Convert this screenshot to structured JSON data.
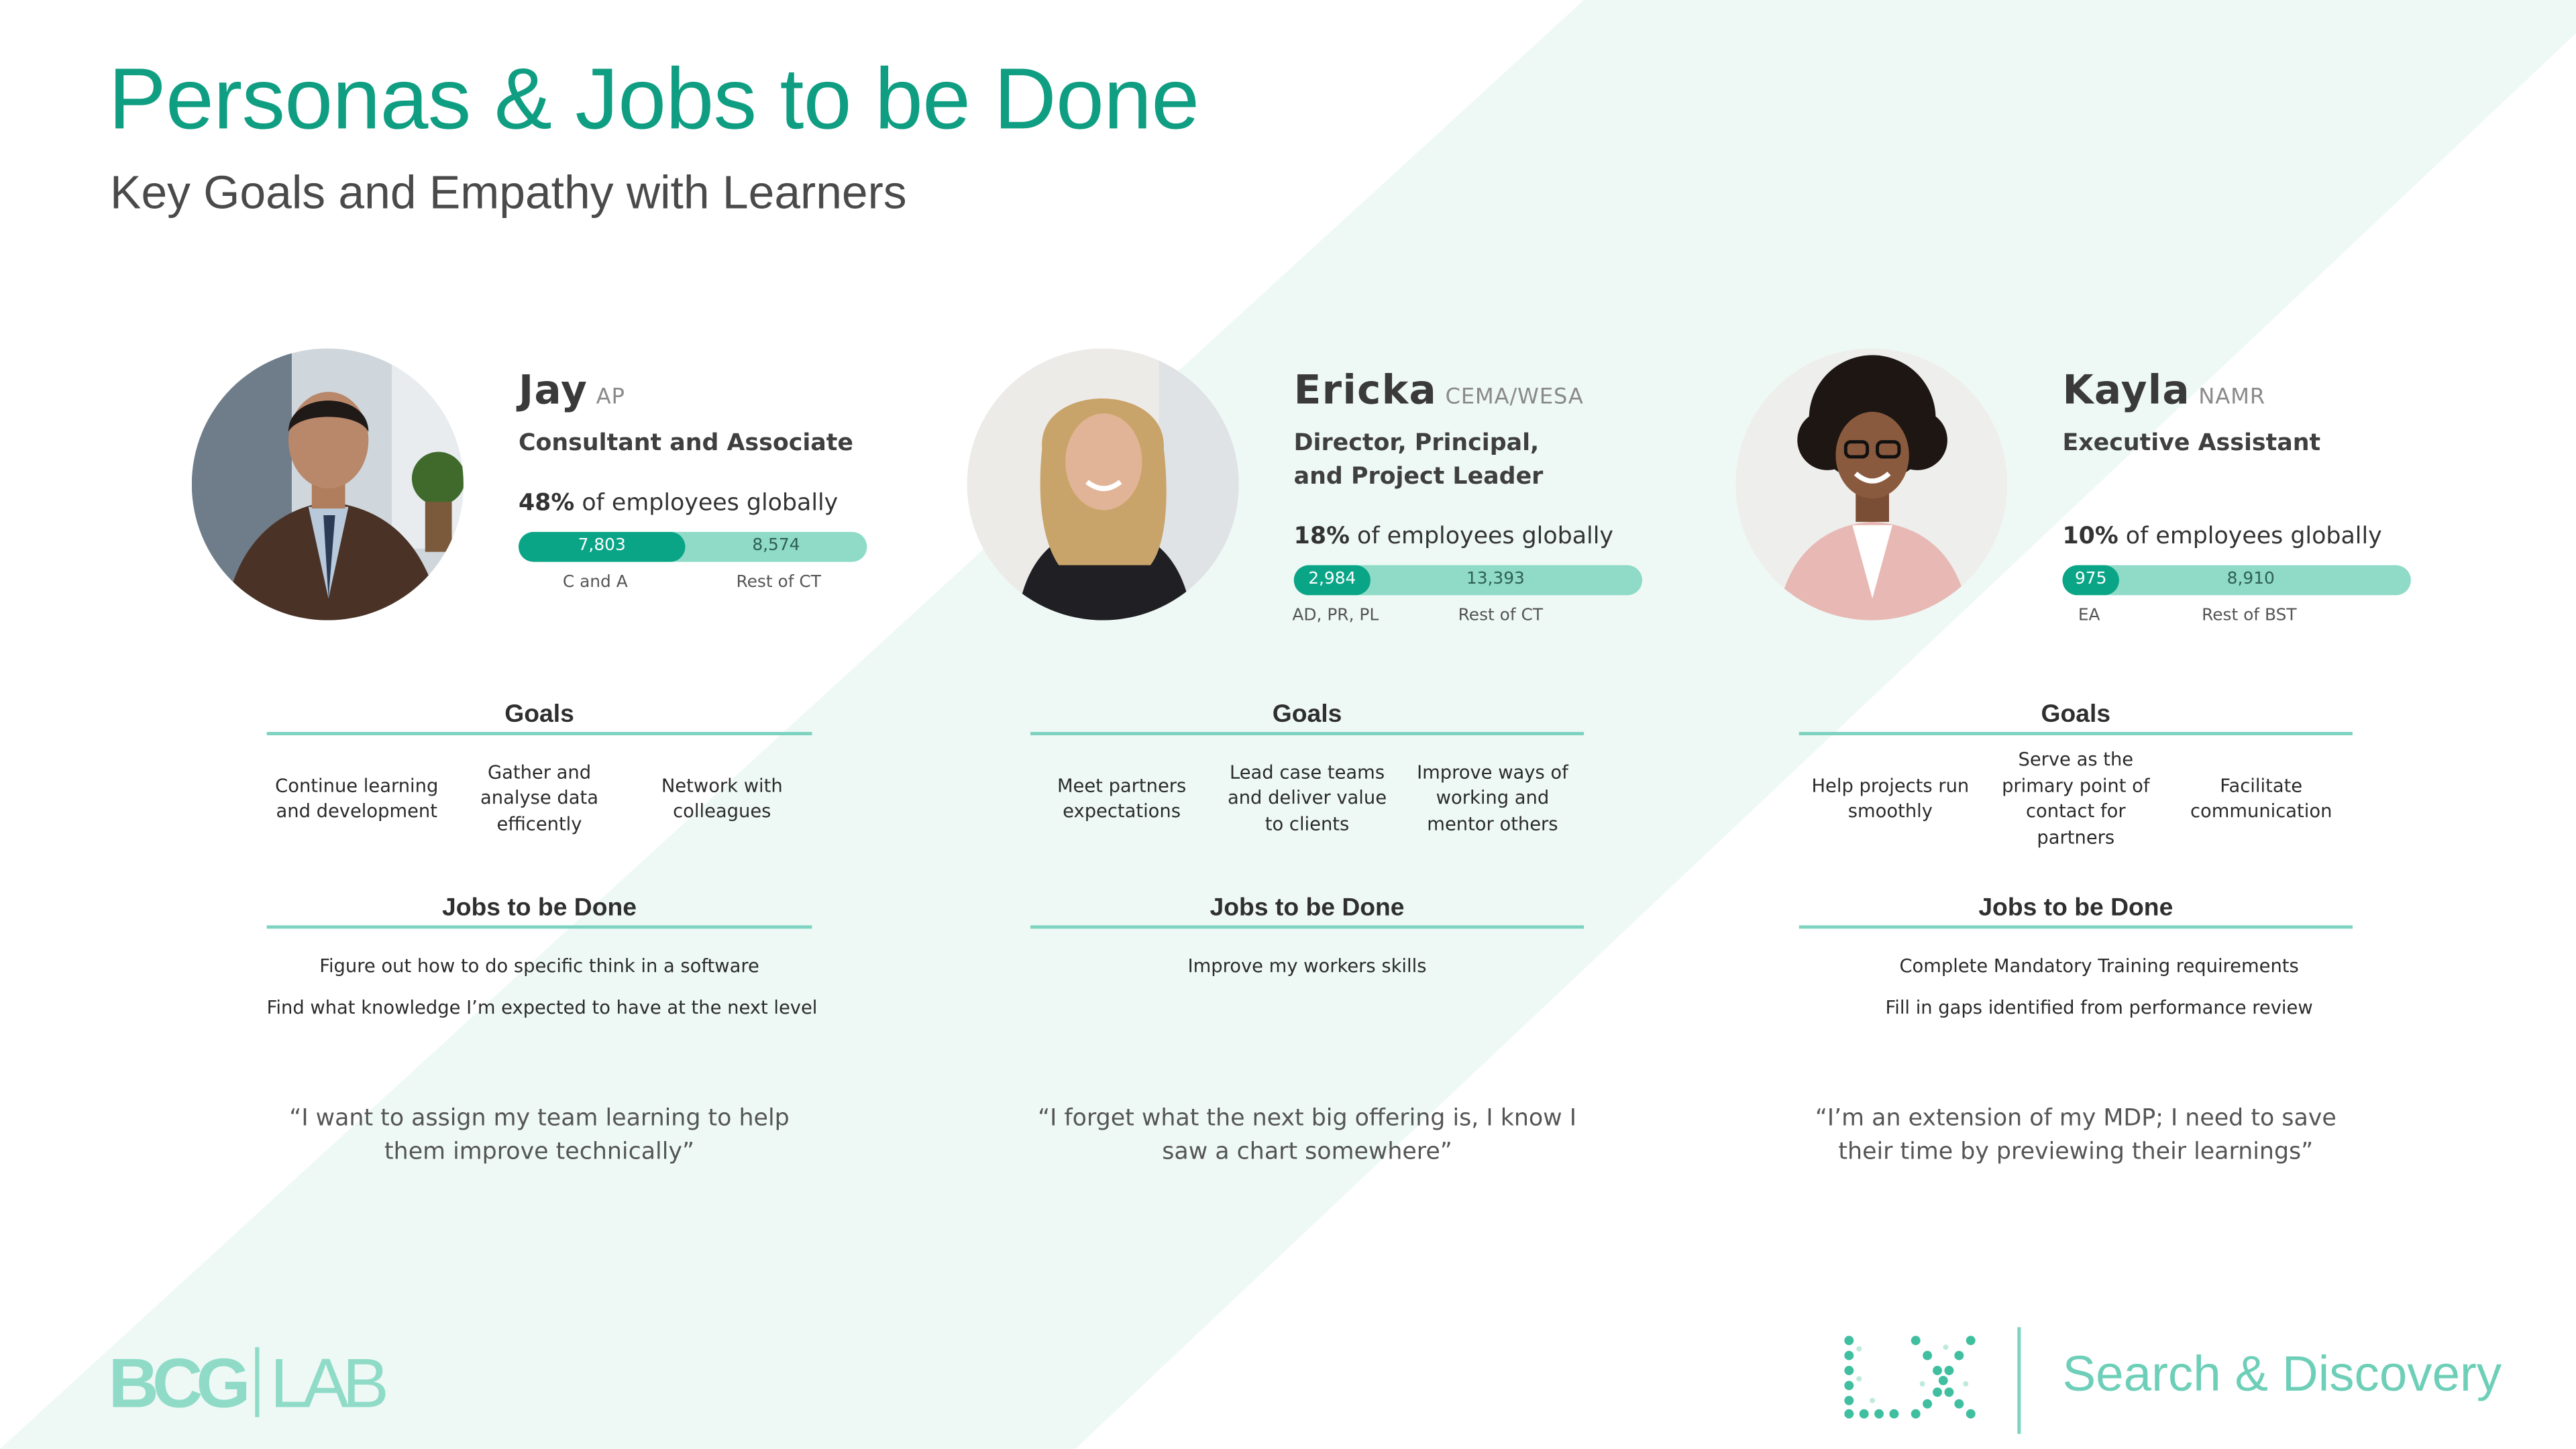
{
  "slide": {
    "title": "Personas & Jobs to be Done",
    "subtitle": "Key Goals and Empathy with Learners"
  },
  "colors": {
    "brand_green": "#0f9e82",
    "bar_dark": "#0aa587",
    "bar_light": "#8fdbc7",
    "rule": "#7dd3c0",
    "diagonal_band": "#eef9f5"
  },
  "personas": [
    {
      "name": "Jay",
      "region": "AP",
      "role": "Consultant and Associate",
      "share_percent": "48%",
      "share_text": "of employees globally",
      "bar": {
        "fill_fraction": 0.476,
        "segment_a": "7,803",
        "segment_b": "8,574",
        "label_a": "C and A",
        "label_b": "Rest of CT"
      },
      "goals_heading": "Goals",
      "goals": [
        "Continue learning and development",
        "Gather and analyse data efficently",
        "Network with colleagues"
      ],
      "jobs_heading": "Jobs to be Done",
      "jobs": [
        "Figure out how to do specific think in a software",
        "Find what knowledge I’m expected to have at the next level"
      ],
      "quote": "“I want to assign my team learning to help them improve technically”"
    },
    {
      "name": "Ericka",
      "region": "CEMA/WESA",
      "role": "Director, Principal, and Project Leader",
      "share_percent": "18%",
      "share_text": "of employees globally",
      "bar": {
        "fill_fraction": 0.22,
        "segment_a": "2,984",
        "segment_b": "13,393",
        "label_a": "AD, PR, PL",
        "label_b": "Rest of CT"
      },
      "goals_heading": "Goals",
      "goals": [
        "Meet partners expectations",
        "Lead case teams and deliver value to clients",
        "Improve ways of working and mentor others"
      ],
      "jobs_heading": "Jobs to be Done",
      "jobs": [
        "Improve my workers skills"
      ],
      "quote": "“I forget what the next big offering is, I know I saw a chart somewhere”"
    },
    {
      "name": "Kayla",
      "region": "NAMR",
      "role": "Executive Assistant",
      "share_percent": "10%",
      "share_text": "of employees globally",
      "bar": {
        "fill_fraction": 0.165,
        "segment_a": "975",
        "segment_b": "8,910",
        "label_a": "EA",
        "label_b": "Rest of BST"
      },
      "goals_heading": "Goals",
      "goals": [
        "Help projects run smoothly",
        "Serve as the primary point of contact for partners",
        "Facilitate communication"
      ],
      "jobs_heading": "Jobs to be Done",
      "jobs": [
        "Complete Mandatory Training requirements",
        "Fill in gaps identified from performance review"
      ],
      "quote": "“I’m an extension of my MDP;  I need to save their time by previewing their learnings”"
    }
  ],
  "footer": {
    "logo_left": "BCG|LAB",
    "logo_lx": "LX",
    "brand_text": "Search & Discovery"
  }
}
